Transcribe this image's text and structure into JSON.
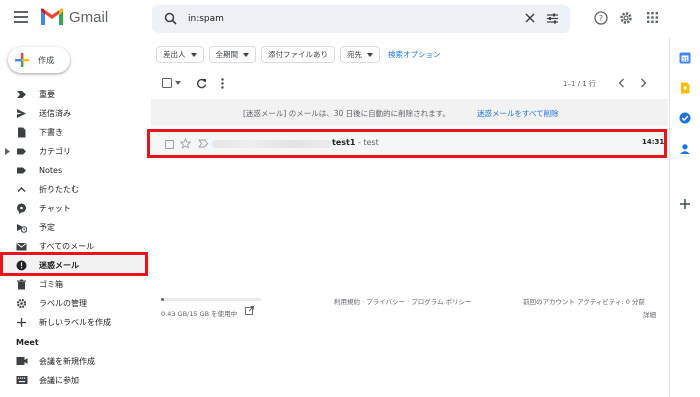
{
  "header": {
    "app_name": "Gmail",
    "search_value": "in:spam",
    "icons": [
      "menu-icon",
      "search-icon",
      "clear-icon",
      "tune-icon",
      "help-icon",
      "settings-icon",
      "apps-icon"
    ]
  },
  "compose": {
    "label": "作成"
  },
  "sidebar": {
    "items": [
      {
        "label": "重要",
        "icon": "label-important-icon"
      },
      {
        "label": "送信済み",
        "icon": "send-icon"
      },
      {
        "label": "下書き",
        "icon": "draft-icon"
      },
      {
        "label": "カテゴリ",
        "icon": "label-icon"
      },
      {
        "label": "Notes",
        "icon": "label-icon"
      },
      {
        "label": "折りたたむ",
        "icon": "chevron-up-icon"
      },
      {
        "label": "チャット",
        "icon": "chat-icon"
      },
      {
        "label": "予定",
        "icon": "schedule-icon"
      },
      {
        "label": "すべてのメール",
        "icon": "mail-icon"
      },
      {
        "label": "迷惑メール",
        "icon": "report-icon",
        "active": true
      },
      {
        "label": "ゴミ箱",
        "icon": "trash-icon"
      },
      {
        "label": "ラベルの管理",
        "icon": "settings-icon"
      },
      {
        "label": "新しいラベルを作成",
        "icon": "plus-icon"
      }
    ],
    "meet": {
      "title": "Meet",
      "items": [
        {
          "label": "会議を新規作成",
          "icon": "video-icon"
        },
        {
          "label": "会議に参加",
          "icon": "keyboard-icon"
        }
      ]
    }
  },
  "filters": {
    "chips": [
      "差出人",
      "全期間",
      "添付ファイルあり",
      "宛先"
    ],
    "advanced": "検索オプション"
  },
  "toolbar": {
    "pagination": "1–1 / 1 行"
  },
  "banner": {
    "text": "[迷惑メール] のメールは、30 日後に自動的に削除されます。",
    "link": "迷惑メールをすべて削除"
  },
  "email": {
    "subject": "test1",
    "snippet": " - test",
    "time": "14:31"
  },
  "footer": {
    "storage": "0.43 GB/15 GB を使用中",
    "storage_fraction": 0.03,
    "links": "利用規約 · プライバシー · プログラム ポリシー",
    "activity": "前回のアカウント アクティビティ: 0 分前",
    "details": "詳細"
  },
  "colors": {
    "highlight": "#e8141c",
    "link": "#1a73e8",
    "gmail_red": "#ea4335"
  }
}
